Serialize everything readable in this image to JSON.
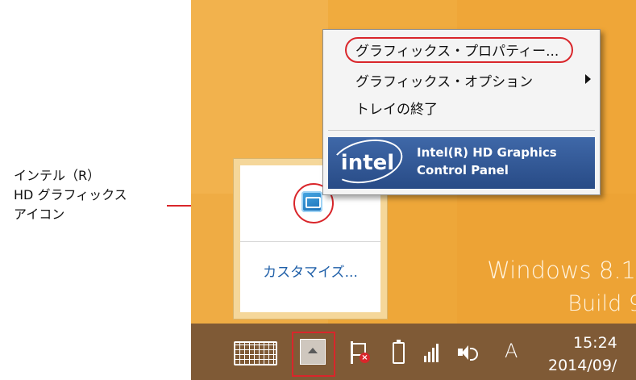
{
  "callout": {
    "line1": "インテル（R）",
    "line2": "HD グラフィックス",
    "line3": "アイコン"
  },
  "desktop": {
    "watermark_title": "Windows 8.1",
    "watermark_build": "Build 9"
  },
  "context_menu": {
    "items": [
      {
        "label": "グラフィックス・プロパティー...",
        "highlighted": true
      },
      {
        "label": "グラフィックス・オプション",
        "has_submenu": true
      },
      {
        "label": "トレイの終了"
      }
    ],
    "intel_logo": "intel",
    "intel_line1": "Intel(R) HD Graphics",
    "intel_line2": "Control Panel"
  },
  "overflow_panel": {
    "icon": "intel-hd-graphics-tray-icon",
    "customize_label": "カスタマイズ..."
  },
  "taskbar": {
    "icons": [
      "touch-keyboard-icon",
      "show-hidden-icons-button",
      "action-center-flag-icon",
      "battery-icon",
      "network-signal-icon",
      "volume-icon"
    ],
    "ime_mode": "A",
    "clock_time": "15:24",
    "clock_date": "2014/09/"
  },
  "colors": {
    "desktop_orange": "#f0ab3e",
    "taskbar_brown": "#7f5a36",
    "annotation_red": "#d9262b",
    "intel_blue": "#2f5594",
    "link_blue": "#1f5fa8"
  }
}
